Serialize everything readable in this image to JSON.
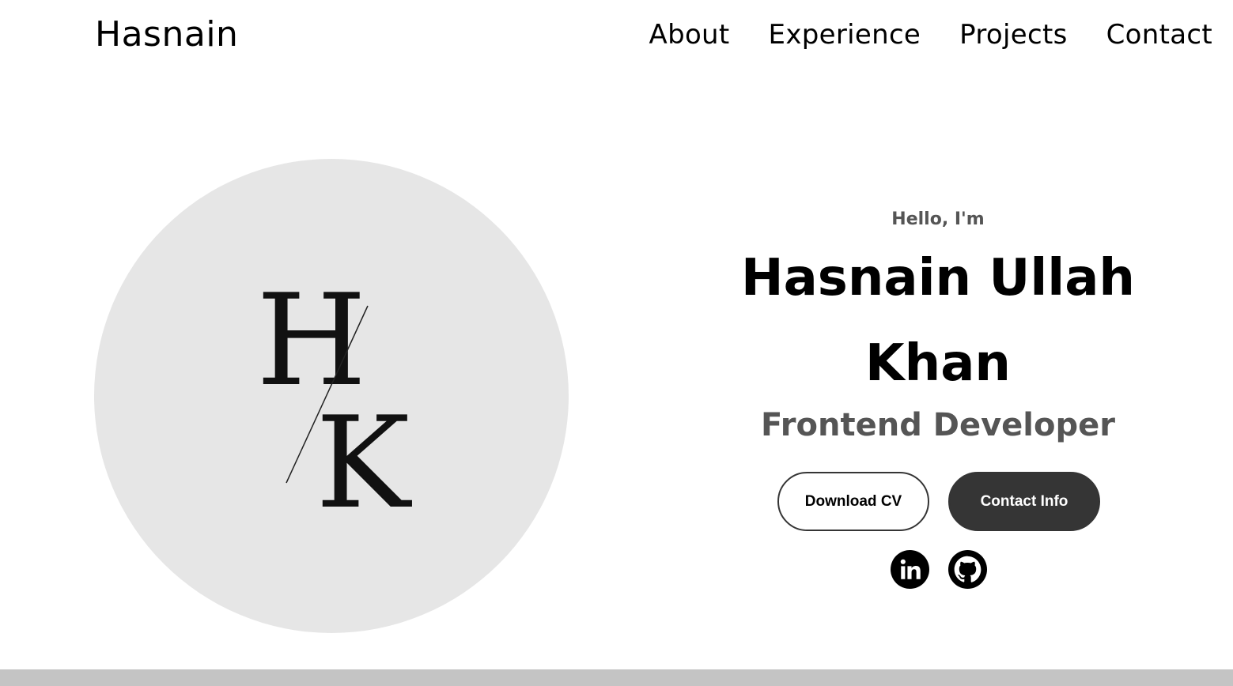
{
  "nav": {
    "logo": "Hasnain",
    "links": [
      "About",
      "Experience",
      "Projects",
      "Contact"
    ]
  },
  "profile": {
    "monogram_top": "H",
    "monogram_bottom": "K"
  },
  "hero": {
    "greeting": "Hello, I'm",
    "name_line1": "Hasnain Ullah",
    "name_line2": "Khan",
    "role": "Frontend Developer"
  },
  "buttons": {
    "download_cv": "Download CV",
    "contact_info": "Contact Info"
  },
  "socials": {
    "icons": [
      "linkedin-icon",
      "github-icon"
    ]
  },
  "colors": {
    "background": "#ffffff",
    "text": "#000000",
    "muted_text": "#555555",
    "circle_bg": "#e6e6e6",
    "button_dark": "#353535",
    "footer_bar": "#c4c4c4"
  }
}
